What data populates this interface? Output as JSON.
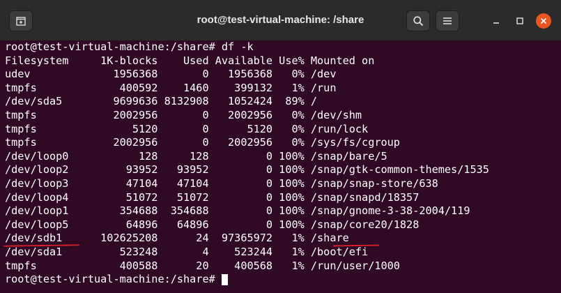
{
  "window": {
    "title": "root@test-virtual-machine: /share"
  },
  "icons": {
    "new_tab": "new-tab-icon",
    "search": "search-icon",
    "menu": "hamburger-menu-icon",
    "minimize": "minimize-icon",
    "maximize": "maximize-icon",
    "close": "close-icon"
  },
  "colors": {
    "terminal_background": "#300a24",
    "titlebar": "#2b2b2b",
    "text": "#ffffff",
    "close_button": "#e95420",
    "annotation": "#e0202a"
  },
  "terminal": {
    "lines": [
      "root@test-virtual-machine:/share# df -k",
      "Filesystem     1K-blocks    Used Available Use% Mounted on",
      "udev             1956368       0   1956368   0% /dev",
      "tmpfs             400592    1460    399132   1% /run",
      "/dev/sda5        9699636 8132908   1052424  89% /",
      "tmpfs            2002956       0   2002956   0% /dev/shm",
      "tmpfs               5120       0      5120   0% /run/lock",
      "tmpfs            2002956       0   2002956   0% /sys/fs/cgroup",
      "/dev/loop0           128     128         0 100% /snap/bare/5",
      "/dev/loop2         93952   93952         0 100% /snap/gtk-common-themes/1535",
      "/dev/loop3         47104   47104         0 100% /snap/snap-store/638",
      "/dev/loop4         51072   51072         0 100% /snap/snapd/18357",
      "/dev/loop1        354688  354688         0 100% /snap/gnome-3-38-2004/119",
      "/dev/loop5         64896   64896         0 100% /snap/core20/1828",
      "/dev/sdb1      102625208      24  97365972   1% /share",
      "/dev/sda1         523248       4    523244   1% /boot/efi",
      "tmpfs             400588      20    400568   1% /run/user/1000"
    ],
    "prompt": "root@test-virtual-machine:/share# "
  }
}
